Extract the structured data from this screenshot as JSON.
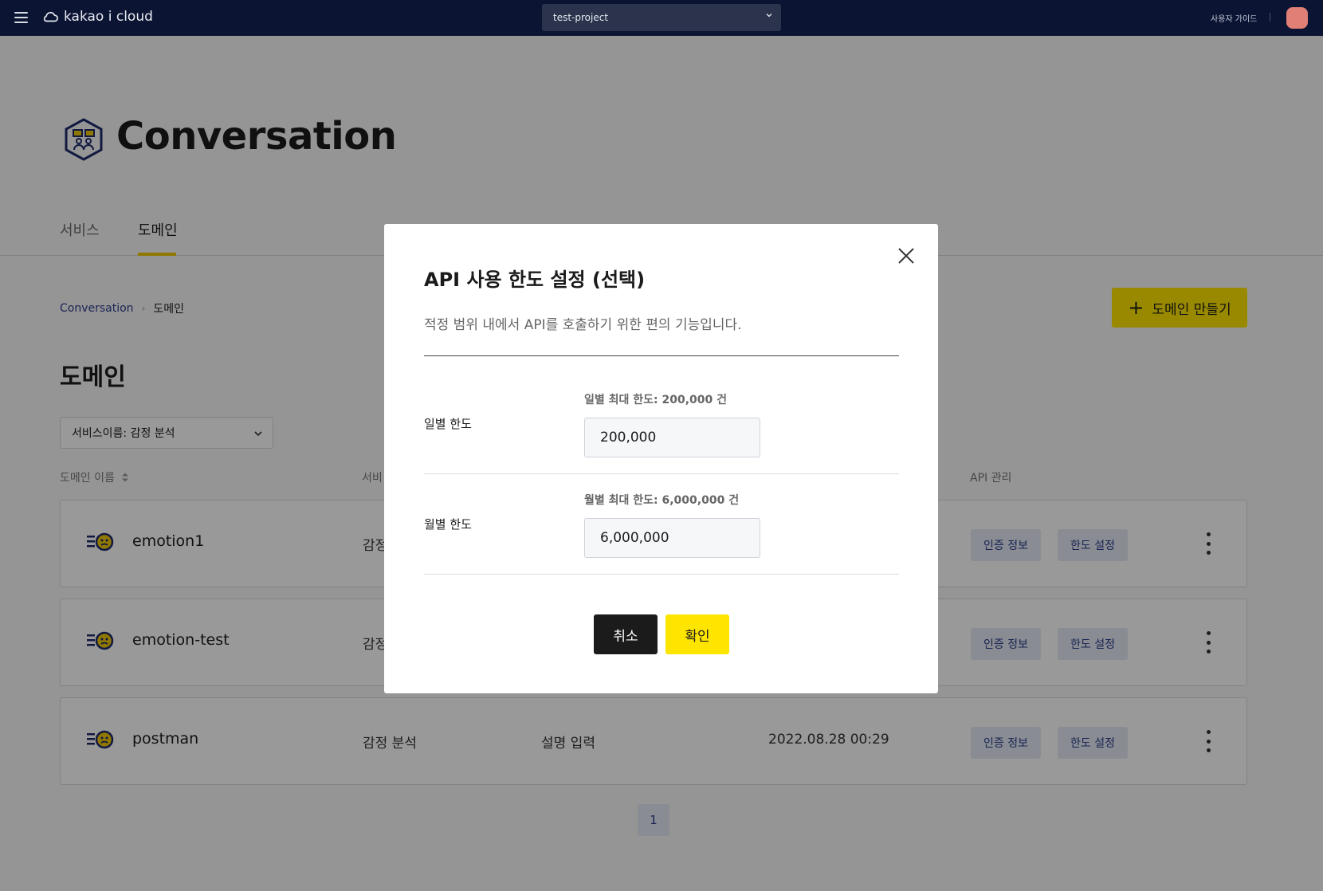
{
  "header": {
    "brand_name": "kakao i cloud",
    "project": "test-project",
    "guide_label": "사용자 가이드"
  },
  "page": {
    "title": "Conversation",
    "tabs": [
      {
        "label": "서비스",
        "active": false
      },
      {
        "label": "도메인",
        "active": true
      }
    ],
    "breadcrumb": {
      "parent": "Conversation",
      "current": "도메인"
    },
    "create_button_label": "도메인 만들기",
    "section_title": "도메인",
    "filter_value": "서비스이름: 감정 분석"
  },
  "table": {
    "columns": [
      "도메인 이름",
      "서비",
      "API 관리"
    ],
    "rows": [
      {
        "name": "emotion1",
        "service": "감정",
        "description": "",
        "created": "",
        "auth_label": "인증 정보",
        "limit_label": "한도 설정"
      },
      {
        "name": "emotion-test",
        "service": "감정",
        "description": "",
        "created": "",
        "auth_label": "인증 정보",
        "limit_label": "한도 설정"
      },
      {
        "name": "postman",
        "service": "감정 분석",
        "description": "설명 입력",
        "created": "2022.08.28 00:29",
        "auth_label": "인증 정보",
        "limit_label": "한도 설정"
      }
    ]
  },
  "pagination": {
    "current_page": "1"
  },
  "modal": {
    "title": "API 사용 한도 설정 (선택)",
    "description": "적정 범위 내에서 API를 호출하기 위한 편의 기능입니다.",
    "daily": {
      "label": "일별 한도",
      "hint": "일별 최대 한도: 200,000 건",
      "value": "200,000"
    },
    "monthly": {
      "label": "월별 한도",
      "hint": "월별 최대 한도: 6,000,000 건",
      "value": "6,000,000"
    },
    "cancel_label": "취소",
    "confirm_label": "확인"
  },
  "colors": {
    "topbar": "#0b1433",
    "accent_yellow": "#fee500",
    "link_blue": "#2b3d8c",
    "pill_bg": "#e4e9f4"
  }
}
